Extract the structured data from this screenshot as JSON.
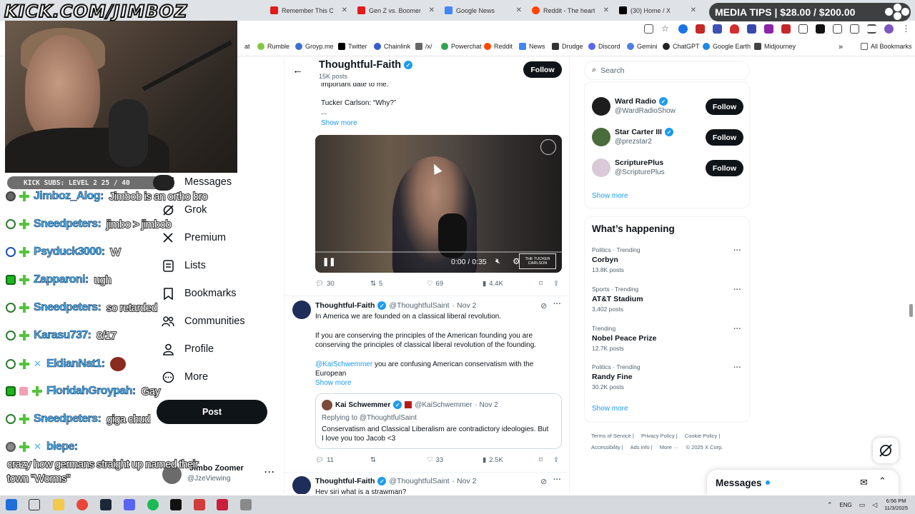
{
  "browser": {
    "tabs": [
      {
        "title": "Remember This Com",
        "favicon_color": "#e21b1b"
      },
      {
        "title": "Gen Z vs. Boomers:",
        "favicon_color": "#e21b1b"
      },
      {
        "title": "Google News",
        "favicon_color": "#4285f4"
      },
      {
        "title": "Reddit - The heart of",
        "favicon_color": "#ff4500"
      },
      {
        "title": "(30) Home / X",
        "favicon_color": "#000000"
      }
    ],
    "bookmarks": [
      "Rumble",
      "Groyp.me",
      "Twitter",
      "Chainlink",
      "/x/",
      "Powerchat",
      "Reddit",
      "News",
      "Drudge",
      "Discord",
      "Gemini",
      "ChatGPT",
      "Google Earth",
      "Midjourney"
    ],
    "all_bookmarks": "All Bookmarks",
    "bookmark_prefix": "at"
  },
  "overlay": {
    "title": "KICK.COM/JIMBOZ",
    "media_tips": "MEDIA TIPS | $28.00 / $200.00",
    "kick_subs": "KICK SUBS: LEVEL 2 25 / 40"
  },
  "chat": [
    {
      "user": "Jimboz_Alog:",
      "msg": "Jimbob is an ortho bro",
      "badge": "avatar"
    },
    {
      "user": "Sneedpeters:",
      "msg": "jimbo > jimbob",
      "badge": "circle"
    },
    {
      "user": "Psyduck3000:",
      "msg": "W",
      "badge": "blue"
    },
    {
      "user": "Zapparoni:",
      "msg": "ugh",
      "badge": "k"
    },
    {
      "user": "Sneedpeters:",
      "msg": "so retarded",
      "badge": "circle"
    },
    {
      "user": "Karasu737:",
      "msg": "8/17",
      "badge": "circle"
    },
    {
      "user": "EldianNat1:",
      "msg": "",
      "badge": "circle"
    },
    {
      "user": "FloridahGroypah:",
      "msg": "Gay",
      "badge": "k"
    },
    {
      "user": "Sneedpeters:",
      "msg": "giga chud",
      "badge": "circle"
    },
    {
      "user": "biepe:",
      "msg": "",
      "badge": "avatar"
    }
  ],
  "chat_continuation": [
    "crazy how germans straight up named their",
    "town \"Worms\""
  ],
  "nav": {
    "items": [
      "Messages",
      "Grok",
      "Premium",
      "Lists",
      "Bookmarks",
      "Communities",
      "Profile",
      "More"
    ],
    "post_label": "Post",
    "account_name": "Jimbo Zoomer",
    "account_handle": "@JzeViewing"
  },
  "profile_header": {
    "name": "Thoughtful-Faith",
    "posts": "15K posts",
    "follow": "Follow"
  },
  "tweet1": {
    "quote_lines": [
      "important date to me.\"",
      "",
      "Tucker Carlson: “Why?”",
      "..."
    ],
    "show_more": "Show more",
    "video_time": "0:00 / 0:35",
    "video_logo": "THE TUCKER CARLSON",
    "stats": {
      "replies": "30",
      "reposts": "5",
      "likes": "69",
      "views": "4.4K"
    }
  },
  "tweet2": {
    "name": "Thoughtful-Faith",
    "handle": "@ThoughtfulSaint",
    "date": "· Nov 2",
    "line1": "In America we are founded on a classical liberal revolution.",
    "para2_l1": "If you are conserving the principles of the American founding you are",
    "para2_l2": "conserving the principles of classical liberal revolution of the founding.",
    "mention": "@KaiSchwemmer",
    "para3_l1": " you are confusing American conservatism with the",
    "para3_l2": "European",
    "show_more": "Show more",
    "quote": {
      "name": "Kai Schwemmer",
      "handle": "@KaiSchwemmer",
      "date": "· Nov 2",
      "replying": "Replying to @ThoughtfulSaint",
      "text_l1": "Conservatism and Classical Liberalism are contradictory ideologies. But",
      "text_l2": "I love you too Jacob <3"
    },
    "stats": {
      "replies": "11",
      "likes": "33",
      "views": "2.5K"
    }
  },
  "tweet3": {
    "name": "Thoughtful-Faith",
    "handle": "@ThoughtfulSaint",
    "date": "· Nov 2",
    "text": "Hey siri what is a strawman?"
  },
  "right": {
    "search_placeholder": "Search",
    "who_to_follow": [
      {
        "name": "Ward Radio",
        "handle": "@WardRadioShow",
        "avatar_color": "#1d1d1d"
      },
      {
        "name": "Star Carter III",
        "handle": "@prezstar2",
        "avatar_color": "#4a6b3a"
      },
      {
        "name": "ScripturePlus",
        "handle": "@ScripturePlus",
        "avatar_color": "#d9c9d9"
      }
    ],
    "follow_label": "Follow",
    "show_more": "Show more",
    "whats_happening": "What’s happening",
    "trends": [
      {
        "cat": "Politics · Trending",
        "name": "Corbyn",
        "count": "13.8K posts"
      },
      {
        "cat": "Sports · Trending",
        "name": "AT&T Stadium",
        "count": "3,402 posts"
      },
      {
        "cat": "Trending",
        "name": "Nobel Peace Prize",
        "count": "12.7K posts"
      },
      {
        "cat": "Politics · Trending",
        "name": "Randy Fine",
        "count": "30.2K posts"
      }
    ],
    "trends_show_more": "Show more",
    "footer": [
      "Terms of Service |",
      "Privacy Policy |",
      "Cookie Policy |",
      "Accessibility |",
      "Ads info |",
      "More ···",
      "© 2025 X Corp."
    ],
    "messages": "Messages"
  },
  "taskbar": {
    "lang": "ENG",
    "time": "6:56 PM",
    "date": "11/3/2025"
  }
}
